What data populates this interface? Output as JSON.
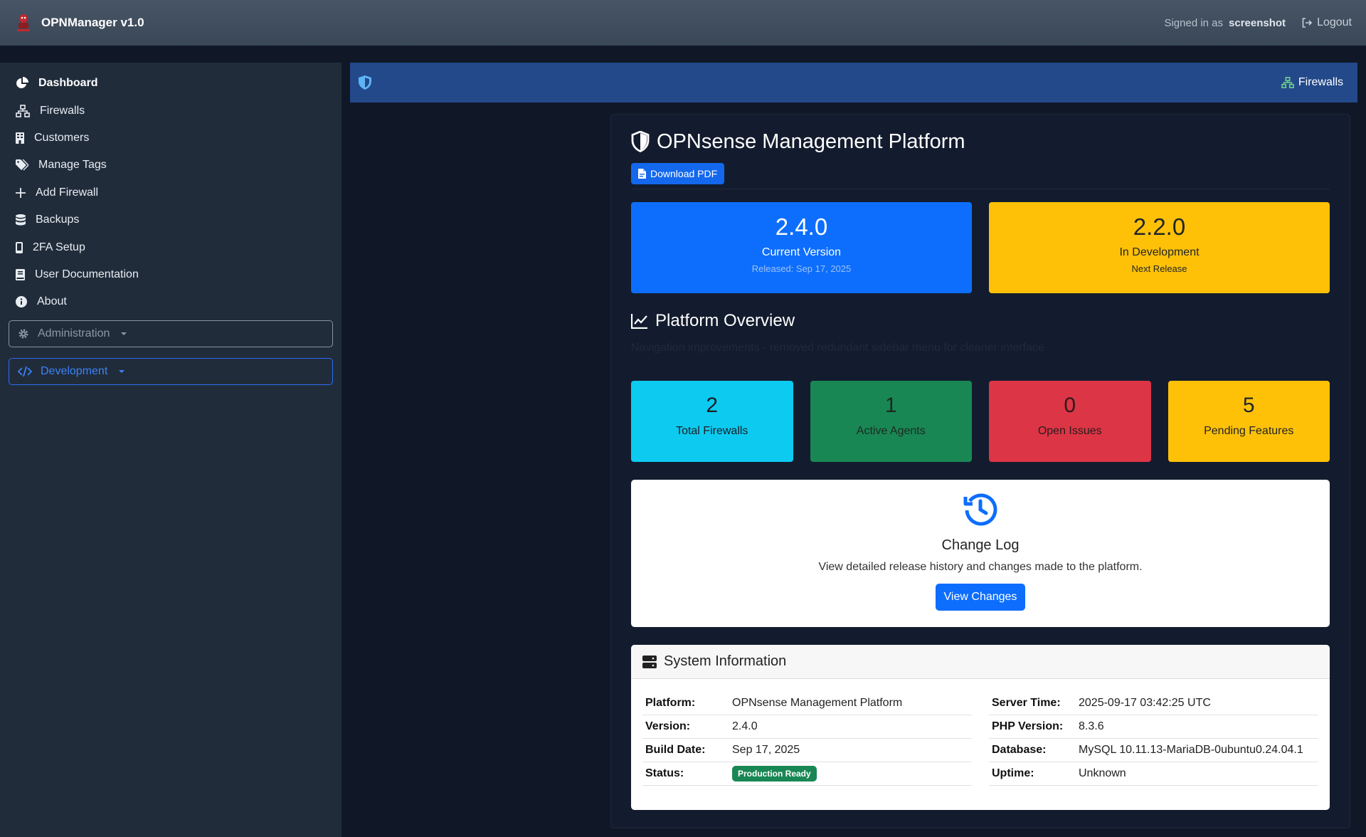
{
  "app": {
    "title": "OPNManager v1.0"
  },
  "topbar": {
    "signed_in_label": "Signed in as",
    "username": "screenshot",
    "logout_label": "Logout"
  },
  "sidebar": {
    "items": [
      {
        "label": "Dashboard",
        "icon": "pie-chart-icon"
      },
      {
        "label": "Firewalls",
        "icon": "network-icon"
      },
      {
        "label": "Customers",
        "icon": "building-icon"
      },
      {
        "label": "Manage Tags",
        "icon": "tags-icon"
      },
      {
        "label": "Add Firewall",
        "icon": "plus-icon"
      },
      {
        "label": "Backups",
        "icon": "database-icon"
      },
      {
        "label": "2FA Setup",
        "icon": "mobile-icon"
      },
      {
        "label": "User Documentation",
        "icon": "book-icon"
      },
      {
        "label": "About",
        "icon": "info-icon"
      }
    ],
    "administration_label": "Administration",
    "development_label": "Development"
  },
  "content_bar": {
    "firewalls_link": "Firewalls"
  },
  "main": {
    "title": "OPNsense Management Platform",
    "download_pdf": "Download PDF",
    "current_version": {
      "number": "2.4.0",
      "label": "Current Version",
      "sub": "Released: Sep 17, 2025"
    },
    "dev_version": {
      "number": "2.2.0",
      "label": "In Development",
      "sub": "Next Release"
    },
    "overview_title": "Platform Overview",
    "overview_note": "Navigation improvements - removed redundant sidebar menu for cleaner interface",
    "stats": [
      {
        "value": "2",
        "label": "Total Firewalls"
      },
      {
        "value": "1",
        "label": "Active Agents"
      },
      {
        "value": "0",
        "label": "Open Issues"
      },
      {
        "value": "5",
        "label": "Pending Features"
      }
    ],
    "changelog": {
      "title": "Change Log",
      "description": "View detailed release history and changes made to the platform.",
      "button": "View Changes"
    },
    "sysinfo": {
      "title": "System Information",
      "left": [
        {
          "key": "Platform:",
          "value": "OPNsense Management Platform"
        },
        {
          "key": "Version:",
          "value": "2.4.0"
        },
        {
          "key": "Build Date:",
          "value": "Sep 17, 2025"
        },
        {
          "key": "Status:",
          "value": "Production Ready"
        }
      ],
      "right": [
        {
          "key": "Server Time:",
          "value": "2025-09-17 03:42:25 UTC"
        },
        {
          "key": "PHP Version:",
          "value": "8.3.6"
        },
        {
          "key": "Database:",
          "value": "MySQL 10.11.13-MariaDB-0ubuntu0.24.04.1"
        },
        {
          "key": "Uptime:",
          "value": "Unknown"
        }
      ]
    }
  },
  "colors": {
    "primary": "#0d6efd",
    "warning": "#ffc107",
    "info": "#0dcaf0",
    "success": "#198754",
    "danger": "#dc3545",
    "header_bar": "#23498a"
  }
}
